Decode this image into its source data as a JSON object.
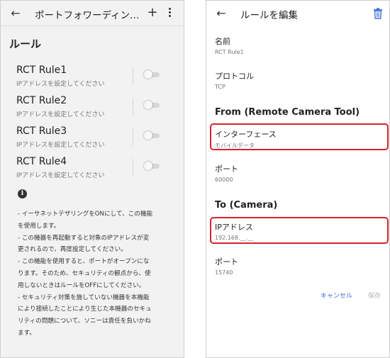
{
  "left_screen": {
    "appbar": {
      "back": "←",
      "title": "ポートフォワーディン…",
      "add": "+"
    },
    "section_title": "ルール",
    "rules": [
      {
        "name": "RCT Rule1",
        "subtitle": "IPアドレスを設定してください",
        "enabled": false
      },
      {
        "name": "RCT Rule2",
        "subtitle": "IPアドレスを設定してください",
        "enabled": false
      },
      {
        "name": "RCT Rule3",
        "subtitle": "IPアドレスを設定してください",
        "enabled": false
      },
      {
        "name": "RCT Rule4",
        "subtitle": "IPアドレスを設定してください",
        "enabled": false
      }
    ],
    "info_icon": "i",
    "notes": [
      "- イーサネットテザリングをONにして、この機能",
      "を使用します。",
      "- この機器を再起動すると対象のIPアドレスが変",
      "更されるので、再度設定してください。",
      "- この機能を使用すると、ポートがオープンにな",
      "ります。そのため、セキュリティの観点から、使",
      "用しないときはルールをOFFにしてください。",
      "- セキュリティ対策を施していない機器を本機能",
      "により接続したことにより生じた本機器のセキュ",
      "リティの問題について、ソニーは責任を負いかね",
      "ます。"
    ]
  },
  "right_screen": {
    "appbar": {
      "back": "←",
      "title": "ルールを編集"
    },
    "name": {
      "label": "名前",
      "value": "RCT Rule1"
    },
    "protocol": {
      "label": "プロトコル",
      "value": "TCP"
    },
    "from_heading": "From (Remote Camera Tool)",
    "interface": {
      "label": "インターフェース",
      "value": "モバイルデータ"
    },
    "from_port": {
      "label": "ポート",
      "value": "60000"
    },
    "to_heading": "To (Camera)",
    "ip_address": {
      "label": "IPアドレス",
      "value": "192.168.__.__"
    },
    "to_port": {
      "label": "ポート",
      "value": "15740"
    },
    "cancel_label": "キャンセル",
    "save_label": "保存"
  },
  "colors": {
    "accent": "#3b6fd8",
    "highlight": "#d8232a",
    "left_bg": "#f2f2f2",
    "disabled_text": "#b5b5b5"
  }
}
